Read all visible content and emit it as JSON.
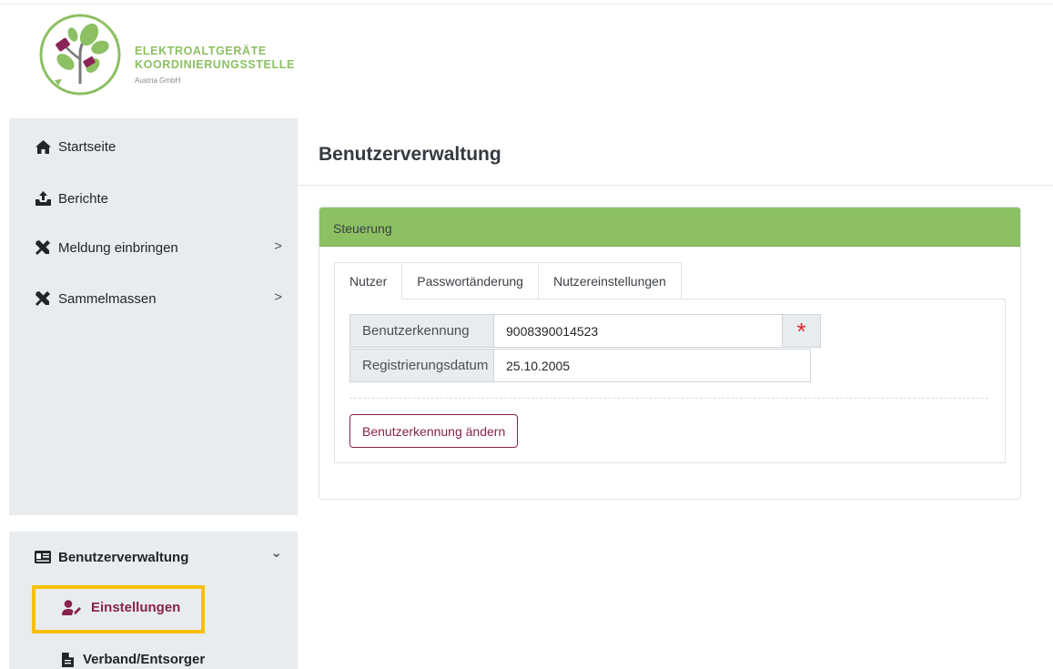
{
  "brand": {
    "line1": "ELEKTROALTGERÄTE",
    "line2": "KOORDINIERUNGSSTELLE",
    "line3": "Austria GmbH"
  },
  "sidebar": {
    "items": [
      {
        "label": "Startseite",
        "icon": "home-icon"
      },
      {
        "label": "Berichte",
        "icon": "upload-tray-icon"
      },
      {
        "label": "Meldung einbringen",
        "icon": "tools-icon",
        "chevron": ">"
      },
      {
        "label": "Sammelmassen",
        "icon": "tools-icon",
        "chevron": ">"
      }
    ],
    "section": {
      "label": "Benutzerverwaltung",
      "icon": "id-card-icon",
      "chevron": "⌄"
    },
    "sub_items": [
      {
        "label": "Einstellungen",
        "icon": "user-edit-icon",
        "active": true
      },
      {
        "label": "Verband/Entsorger",
        "icon": "document-icon"
      }
    ]
  },
  "main": {
    "title": "Benutzerverwaltung",
    "card": {
      "header": "Steuerung",
      "tabs": [
        {
          "label": "Nutzer",
          "active": true
        },
        {
          "label": "Passwortänderung"
        },
        {
          "label": "Nutzereinstellungen"
        }
      ],
      "fields": {
        "user_id_label": "Benutzerkennung",
        "user_id_value": "9008390014523",
        "required_marker": "*",
        "reg_date_label": "Registrierungsdatum",
        "reg_date_value": "25.10.2005"
      },
      "change_button": "Benutzerkennung ändern"
    }
  },
  "colors": {
    "brand_green": "#8cc063",
    "accent_wine": "#87214e",
    "highlight": "#f7c002",
    "required_red": "#e3262f",
    "sidebar_bg": "#e9ecef"
  }
}
